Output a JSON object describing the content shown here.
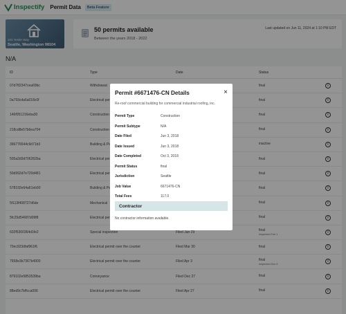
{
  "header": {
    "brand": "Inspectify",
    "page_name": "Permit Data",
    "beta_label": "Beta Feature"
  },
  "property": {
    "address": "101 Yesler Way",
    "city_line": "Seattle, Washington 98104"
  },
  "stats": {
    "title": "50 permits available",
    "subtitle": "Between the years 2018 - 2022",
    "updated": "Last updated on Jun 11, 2024 at 1:10 PM EDT"
  },
  "section_label": "N/A",
  "table": {
    "headers": {
      "id": "ID",
      "type": "Type",
      "date": "Date",
      "status": "Status"
    },
    "rows": [
      {
        "id": "07d782347cea69bc",
        "type": "Withdrawal",
        "date": "",
        "status": "final",
        "status_sub": ""
      },
      {
        "id": "0a793cda6a018c0f",
        "type": "Electrical permit",
        "date": "",
        "status": "final",
        "status_sub": ""
      },
      {
        "id": "146f051216eba30",
        "type": "Construction",
        "date": "",
        "status": "final",
        "status_sub": ""
      },
      {
        "id": "218cd8e57b6ea704",
        "type": "Construction",
        "date": "",
        "status": "final",
        "status_sub": ""
      },
      {
        "id": "396776544c9d71b3",
        "type": "Building & Permit",
        "date": "",
        "status": "inactive",
        "status_sub": ""
      },
      {
        "id": "505a2d3d706262ba",
        "type": "Electrical permit",
        "date": "",
        "status": "final",
        "status_sub": ""
      },
      {
        "id": "50d992d7e720d481",
        "type": "Electrical permit",
        "date": "",
        "status": "final",
        "status_sub": ""
      },
      {
        "id": "578192e64a61eb90",
        "type": "Building & Permit",
        "date": "",
        "status": "final",
        "status_sub": ""
      },
      {
        "id": "5f113f408727d6de",
        "type": "Mechanical",
        "date": "",
        "status": "final",
        "status_sub": ""
      },
      {
        "id": "5fc25d54687d09f8",
        "type": "Electrical permit",
        "date": "",
        "status": "final",
        "status_sub": ""
      },
      {
        "id": "602f5300364d1fe2",
        "type": "Special inspection",
        "date": "Filed Jan 29",
        "status": "final",
        "status_sub": "Inspected Feb 1"
      },
      {
        "id": "70ec923dfaf961f6",
        "type": "Electrical permit over the counter",
        "date": "Filed Mar 30",
        "status": "final",
        "status_sub": ""
      },
      {
        "id": "7658e3b7367b4900",
        "type": "Electrical permit over the counter",
        "date": "Filed Apr 3",
        "status": "final",
        "status_sub": "Inspected Dec 6"
      },
      {
        "id": "879102e5853539ba",
        "type": "Conveyance",
        "date": "Filed Dec 27",
        "status": "final",
        "status_sub": ""
      },
      {
        "id": "88ed9c7bffcca006",
        "type": "Electrical permit over the counter",
        "date": "Filed Apr 27",
        "status": "final",
        "status_sub": ""
      }
    ]
  },
  "modal": {
    "title": "Permit #6671476-CN Details",
    "close_symbol": "×",
    "description": "Re-roof commercial building for commercial industrial roofing, inc.",
    "details": [
      {
        "label": "Permit Type",
        "value": "Construction"
      },
      {
        "label": "Permit Subtype",
        "value": "N/A"
      },
      {
        "label": "Date Filed",
        "value": "Jun 3, 2018"
      },
      {
        "label": "Date Issued",
        "value": "Jun 3, 2018"
      },
      {
        "label": "Date Completed",
        "value": "Oct 3, 2018"
      },
      {
        "label": "Permit Status",
        "value": "final"
      },
      {
        "label": "Jurisdiction",
        "value": "Seattle"
      },
      {
        "label": "Job Value",
        "value": "6671476-CN"
      },
      {
        "label": "Total Fees",
        "value": "117.0"
      }
    ],
    "contractor_heading": "Contractor",
    "contractor_empty": "No contractor information available."
  },
  "colors": {
    "brand_green": "#2e8b57",
    "contractor_bg": "#d6e6e8"
  }
}
